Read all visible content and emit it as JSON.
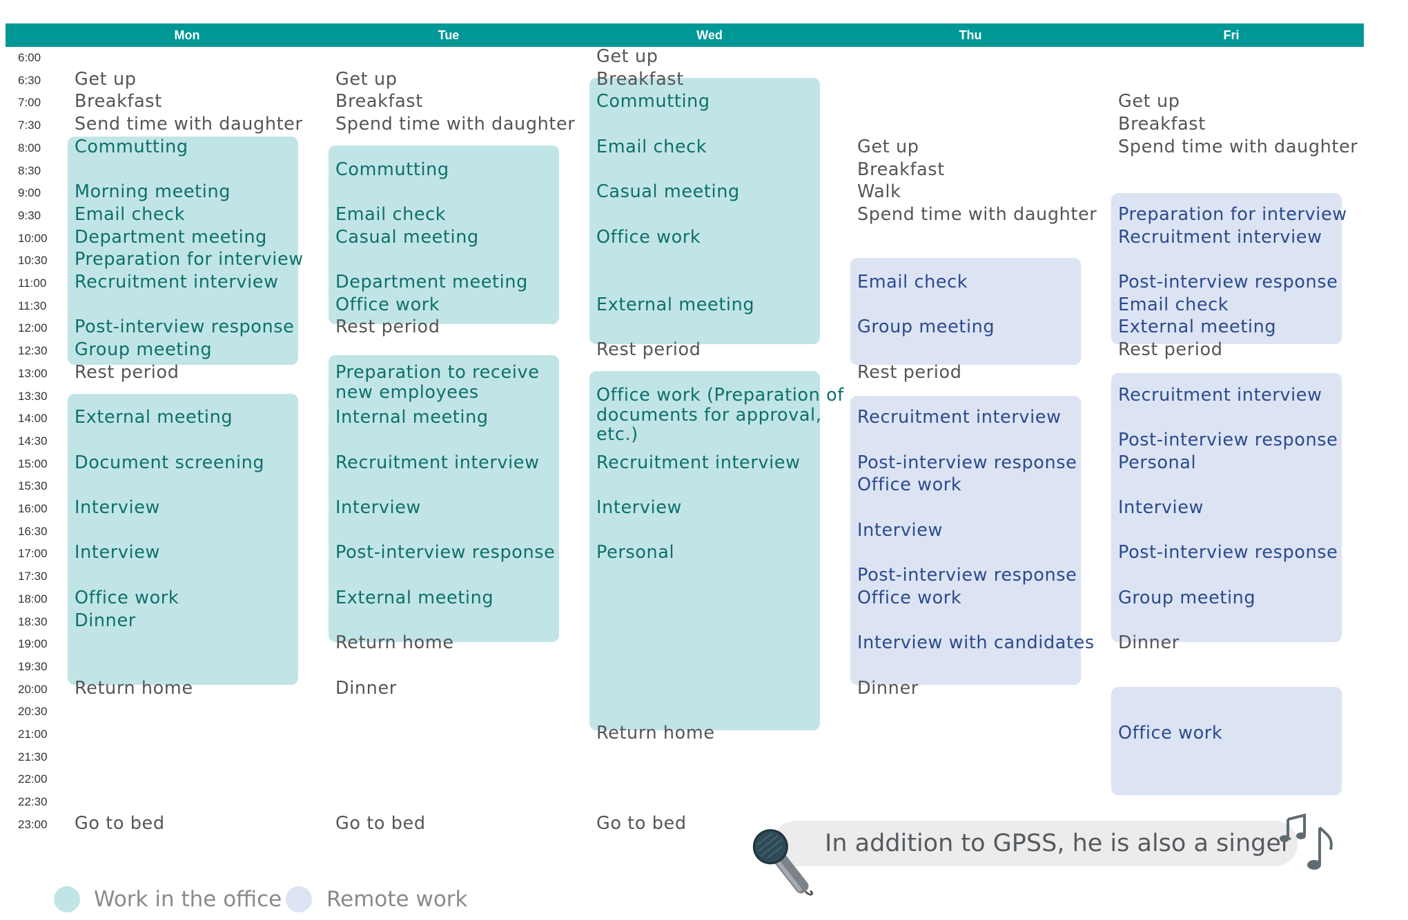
{
  "days": [
    "Mon",
    "Tue",
    "Wed",
    "Thu",
    "Fri"
  ],
  "times": [
    "6:00",
    "6:30",
    "7:00",
    "7:30",
    "8:00",
    "8:30",
    "9:00",
    "9:30",
    "10:00",
    "10:30",
    "11:00",
    "11:30",
    "12:00",
    "12:30",
    "13:00",
    "13:30",
    "14:00",
    "14:30",
    "15:00",
    "15:30",
    "16:00",
    "16:30",
    "17:00",
    "17:30",
    "18:00",
    "18:30",
    "19:00",
    "19:30",
    "20:00",
    "20:30",
    "21:00",
    "21:30",
    "22:00",
    "22:30",
    "23:00"
  ],
  "colors": {
    "header": "#009896",
    "office": "#c1e5e6",
    "remote": "#dce3f3"
  },
  "blocks": [
    {
      "day": 0,
      "start": 4,
      "end": 13.3,
      "type": "office"
    },
    {
      "day": 0,
      "start": 15.4,
      "end": 27.5,
      "type": "office"
    },
    {
      "day": 1,
      "start": 4.4,
      "end": 11.5,
      "type": "office"
    },
    {
      "day": 1,
      "start": 13.7,
      "end": 25.6,
      "type": "office"
    },
    {
      "day": 2,
      "start": 1.4,
      "end": 12.4,
      "type": "office"
    },
    {
      "day": 2,
      "start": 14.4,
      "end": 29.5,
      "type": "office"
    },
    {
      "day": 3,
      "start": 9.4,
      "end": 13.3,
      "type": "remote"
    },
    {
      "day": 3,
      "start": 15.5,
      "end": 27.5,
      "type": "remote"
    },
    {
      "day": 4,
      "start": 6.5,
      "end": 12.4,
      "type": "remote"
    },
    {
      "day": 4,
      "start": 14.5,
      "end": 25.6,
      "type": "remote"
    },
    {
      "day": 4,
      "start": 28.4,
      "end": 32.4,
      "type": "remote"
    }
  ],
  "events": [
    {
      "day": 0,
      "slot": 1,
      "text": "Get up",
      "type": "plain"
    },
    {
      "day": 0,
      "slot": 2,
      "text": "Breakfast",
      "type": "plain"
    },
    {
      "day": 0,
      "slot": 3,
      "text": "Send time with daughter",
      "type": "plain"
    },
    {
      "day": 0,
      "slot": 4,
      "text": "Commutting",
      "type": "office"
    },
    {
      "day": 0,
      "slot": 6,
      "text": "Morning meeting",
      "type": "office"
    },
    {
      "day": 0,
      "slot": 7,
      "text": "Email check",
      "type": "office"
    },
    {
      "day": 0,
      "slot": 8,
      "text": "Department meeting",
      "type": "office"
    },
    {
      "day": 0,
      "slot": 9,
      "text": "Preparation for interview",
      "type": "office"
    },
    {
      "day": 0,
      "slot": 10,
      "text": "Recruitment interview",
      "type": "office"
    },
    {
      "day": 0,
      "slot": 12,
      "text": "Post-interview response",
      "type": "office"
    },
    {
      "day": 0,
      "slot": 13,
      "text": "Group meeting",
      "type": "office"
    },
    {
      "day": 0,
      "slot": 14,
      "text": "Rest period",
      "type": "plain"
    },
    {
      "day": 0,
      "slot": 16,
      "text": "External meeting",
      "type": "office"
    },
    {
      "day": 0,
      "slot": 18,
      "text": "Document screening",
      "type": "office"
    },
    {
      "day": 0,
      "slot": 20,
      "text": "Interview",
      "type": "office"
    },
    {
      "day": 0,
      "slot": 22,
      "text": "Interview",
      "type": "office"
    },
    {
      "day": 0,
      "slot": 24,
      "text": "Office work",
      "type": "office"
    },
    {
      "day": 0,
      "slot": 25,
      "text": "Dinner",
      "type": "office"
    },
    {
      "day": 0,
      "slot": 28,
      "text": "Return home",
      "type": "plain"
    },
    {
      "day": 0,
      "slot": 34,
      "text": "Go to bed",
      "type": "plain"
    },
    {
      "day": 1,
      "slot": 1,
      "text": "Get up",
      "type": "plain"
    },
    {
      "day": 1,
      "slot": 2,
      "text": "Breakfast",
      "type": "plain"
    },
    {
      "day": 1,
      "slot": 3,
      "text": "Spend time with daughter",
      "type": "plain"
    },
    {
      "day": 1,
      "slot": 5,
      "text": "Commutting",
      "type": "office"
    },
    {
      "day": 1,
      "slot": 7,
      "text": "Email check",
      "type": "office"
    },
    {
      "day": 1,
      "slot": 8,
      "text": "Casual meeting",
      "type": "office"
    },
    {
      "day": 1,
      "slot": 10,
      "text": "Department meeting",
      "type": "office"
    },
    {
      "day": 1,
      "slot": 11,
      "text": "Office work",
      "type": "office"
    },
    {
      "day": 1,
      "slot": 12,
      "text": "Rest period",
      "type": "plain"
    },
    {
      "day": 1,
      "slot": 14,
      "text": "Preparation to receive",
      "type": "office"
    },
    {
      "day": 1,
      "slot": 14.9,
      "text": "new employees",
      "type": "office"
    },
    {
      "day": 1,
      "slot": 16,
      "text": "Internal meeting",
      "type": "office"
    },
    {
      "day": 1,
      "slot": 18,
      "text": "Recruitment interview",
      "type": "office"
    },
    {
      "day": 1,
      "slot": 20,
      "text": "Interview",
      "type": "office"
    },
    {
      "day": 1,
      "slot": 22,
      "text": "Post-interview response",
      "type": "office"
    },
    {
      "day": 1,
      "slot": 24,
      "text": "External meeting",
      "type": "office"
    },
    {
      "day": 1,
      "slot": 26,
      "text": "Return home",
      "type": "plain"
    },
    {
      "day": 1,
      "slot": 28,
      "text": "Dinner",
      "type": "plain"
    },
    {
      "day": 1,
      "slot": 34,
      "text": "Go to bed",
      "type": "plain"
    },
    {
      "day": 2,
      "slot": 0,
      "text": "Get up",
      "type": "plain"
    },
    {
      "day": 2,
      "slot": 1,
      "text": "Breakfast",
      "type": "plain"
    },
    {
      "day": 2,
      "slot": 2,
      "text": "Commutting",
      "type": "office"
    },
    {
      "day": 2,
      "slot": 4,
      "text": "Email check",
      "type": "office"
    },
    {
      "day": 2,
      "slot": 6,
      "text": "Casual meeting",
      "type": "office"
    },
    {
      "day": 2,
      "slot": 8,
      "text": "Office work",
      "type": "office"
    },
    {
      "day": 2,
      "slot": 11,
      "text": "External meeting",
      "type": "office"
    },
    {
      "day": 2,
      "slot": 13,
      "text": "Rest period",
      "type": "plain"
    },
    {
      "day": 2,
      "slot": 15,
      "text": "Office work (Preparation of",
      "type": "office"
    },
    {
      "day": 2,
      "slot": 15.9,
      "text": "documents for approval,",
      "type": "office"
    },
    {
      "day": 2,
      "slot": 16.75,
      "text": "etc.)",
      "type": "office"
    },
    {
      "day": 2,
      "slot": 18,
      "text": "Recruitment interview",
      "type": "office"
    },
    {
      "day": 2,
      "slot": 20,
      "text": "Interview",
      "type": "office"
    },
    {
      "day": 2,
      "slot": 22,
      "text": "Personal",
      "type": "office"
    },
    {
      "day": 2,
      "slot": 30,
      "text": "Return home",
      "type": "plain"
    },
    {
      "day": 2,
      "slot": 34,
      "text": "Go to bed",
      "type": "plain"
    },
    {
      "day": 3,
      "slot": 4,
      "text": "Get up",
      "type": "plain"
    },
    {
      "day": 3,
      "slot": 5,
      "text": "Breakfast",
      "type": "plain"
    },
    {
      "day": 3,
      "slot": 6,
      "text": "Walk",
      "type": "plain"
    },
    {
      "day": 3,
      "slot": 7,
      "text": "Spend time with daughter",
      "type": "plain"
    },
    {
      "day": 3,
      "slot": 10,
      "text": "Email check",
      "type": "remote"
    },
    {
      "day": 3,
      "slot": 12,
      "text": "Group meeting",
      "type": "remote"
    },
    {
      "day": 3,
      "slot": 14,
      "text": "Rest period",
      "type": "plain"
    },
    {
      "day": 3,
      "slot": 16,
      "text": "Recruitment interview",
      "type": "remote"
    },
    {
      "day": 3,
      "slot": 18,
      "text": "Post-interview response",
      "type": "remote"
    },
    {
      "day": 3,
      "slot": 19,
      "text": "Office work",
      "type": "remote"
    },
    {
      "day": 3,
      "slot": 21,
      "text": "Interview",
      "type": "remote"
    },
    {
      "day": 3,
      "slot": 23,
      "text": "Post-interview response",
      "type": "remote"
    },
    {
      "day": 3,
      "slot": 24,
      "text": "Office work",
      "type": "remote"
    },
    {
      "day": 3,
      "slot": 26,
      "text": "Interview with candidates",
      "type": "remote"
    },
    {
      "day": 3,
      "slot": 28,
      "text": "Dinner",
      "type": "plain"
    },
    {
      "day": 4,
      "slot": 2,
      "text": "Get up",
      "type": "plain"
    },
    {
      "day": 4,
      "slot": 3,
      "text": "Breakfast",
      "type": "plain"
    },
    {
      "day": 4,
      "slot": 4,
      "text": "Spend time with daughter",
      "type": "plain"
    },
    {
      "day": 4,
      "slot": 7,
      "text": "Preparation for interview",
      "type": "remote"
    },
    {
      "day": 4,
      "slot": 8,
      "text": "Recruitment interview",
      "type": "remote"
    },
    {
      "day": 4,
      "slot": 10,
      "text": "Post-interview response",
      "type": "remote"
    },
    {
      "day": 4,
      "slot": 11,
      "text": "Email check",
      "type": "remote"
    },
    {
      "day": 4,
      "slot": 12,
      "text": "External meeting",
      "type": "remote"
    },
    {
      "day": 4,
      "slot": 13,
      "text": "Rest period",
      "type": "plain"
    },
    {
      "day": 4,
      "slot": 15,
      "text": "Recruitment interview",
      "type": "remote"
    },
    {
      "day": 4,
      "slot": 17,
      "text": "Post-interview response",
      "type": "remote"
    },
    {
      "day": 4,
      "slot": 18,
      "text": "Personal",
      "type": "remote"
    },
    {
      "day": 4,
      "slot": 20,
      "text": "Interview",
      "type": "remote"
    },
    {
      "day": 4,
      "slot": 22,
      "text": "Post-interview response",
      "type": "remote"
    },
    {
      "day": 4,
      "slot": 24,
      "text": "Group meeting",
      "type": "remote"
    },
    {
      "day": 4,
      "slot": 26,
      "text": "Dinner",
      "type": "plain"
    },
    {
      "day": 4,
      "slot": 30,
      "text": "Office work",
      "type": "remote"
    }
  ],
  "legend": {
    "office_label": "Work in the office",
    "remote_label": "Remote work"
  },
  "note": {
    "text": "In addition to GPSS, he is also a singer",
    "icons": [
      "microphone-icon",
      "music-note-icon"
    ]
  }
}
